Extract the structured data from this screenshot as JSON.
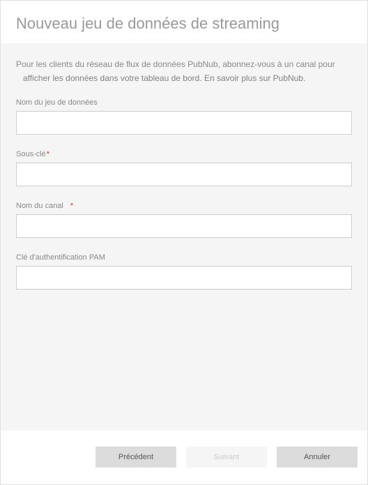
{
  "header": {
    "title": "Nouveau jeu de données de streaming"
  },
  "description": {
    "line1": "Pour les clients du réseau de flux de données PubNub, abonnez-vous à un canal pour",
    "line2": "afficher les données dans votre tableau de bord. En savoir plus sur PubNub."
  },
  "fields": {
    "dataset_name": {
      "label": "Nom du jeu de données",
      "value": ""
    },
    "sub_key": {
      "label": "Sous-clé",
      "value": ""
    },
    "channel_name": {
      "label": "Nom du canal",
      "value": ""
    },
    "pam_auth_key": {
      "label": "Clé d'authentification PAM",
      "value": ""
    }
  },
  "buttons": {
    "previous": "Précédent",
    "next": "Suivant",
    "cancel": "Annuler"
  }
}
